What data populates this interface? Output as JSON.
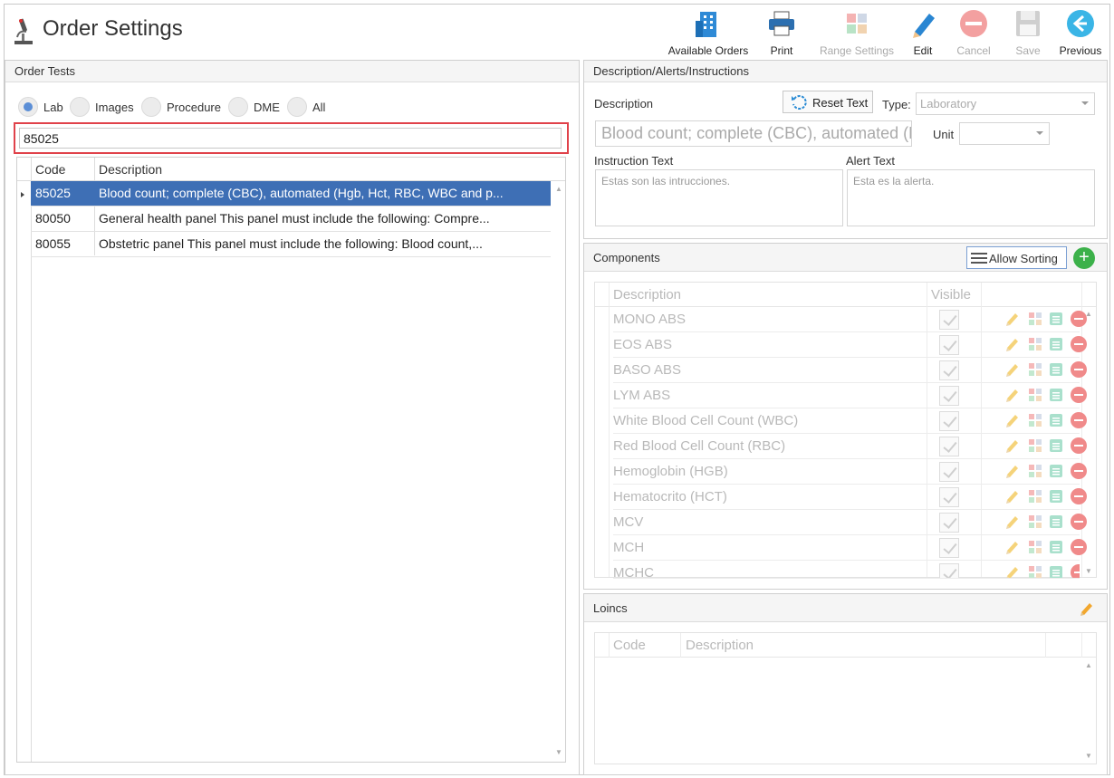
{
  "app": {
    "title": "Order Settings",
    "icon": "microscope-icon"
  },
  "toolbar": [
    {
      "id": "available-orders",
      "label": "Available Orders",
      "icon": "building-icon",
      "enabled": true
    },
    {
      "id": "print",
      "label": "Print",
      "icon": "printer-icon",
      "enabled": true
    },
    {
      "id": "range-settings",
      "label": "Range Settings",
      "icon": "puzzle-icon",
      "enabled": false
    },
    {
      "id": "edit",
      "label": "Edit",
      "icon": "pencil-icon",
      "enabled": true
    },
    {
      "id": "cancel",
      "label": "Cancel",
      "icon": "cancel-icon",
      "enabled": false
    },
    {
      "id": "save",
      "label": "Save",
      "icon": "floppy-icon",
      "enabled": false
    },
    {
      "id": "previous",
      "label": "Previous",
      "icon": "arrow-left-icon",
      "enabled": true
    }
  ],
  "order_tests": {
    "title": "Order Tests",
    "filters": [
      {
        "label": "Lab",
        "selected": true
      },
      {
        "label": "Images",
        "selected": false
      },
      {
        "label": "Procedure",
        "selected": false
      },
      {
        "label": "DME",
        "selected": false
      },
      {
        "label": "All",
        "selected": false
      }
    ],
    "search_value": "85025",
    "columns": {
      "code": "Code",
      "description": "Description"
    },
    "rows": [
      {
        "code": "85025",
        "description": "Blood count; complete (CBC), automated (Hgb, Hct, RBC, WBC and p...",
        "selected": true
      },
      {
        "code": "80050",
        "description": "General health panel This panel must include the following: Compre...",
        "selected": false
      },
      {
        "code": "80055",
        "description": "Obstetric panel This panel must include the following: Blood count,...",
        "selected": false
      }
    ]
  },
  "description_panel": {
    "title": "Description/Alerts/Instructions",
    "description_label": "Description",
    "reset_label": "Reset Text",
    "type_label": "Type:",
    "type_value": "Laboratory",
    "description_value": "Blood count; complete (CBC), automated (H",
    "unit_label": "Unit",
    "unit_value": "",
    "instruction_label": "Instruction Text",
    "instruction_value": "Estas son las intrucciones.",
    "alert_label": "Alert Text",
    "alert_value": "Esta es la alerta."
  },
  "components": {
    "title": "Components",
    "sort_label": "Allow Sorting",
    "columns": {
      "description": "Description",
      "visible": "Visible"
    },
    "rows": [
      "MONO ABS",
      "EOS ABS",
      "BASO ABS",
      "LYM ABS",
      "White Blood Cell Count (WBC)",
      "Red Blood Cell Count (RBC)",
      "Hemoglobin (HGB)",
      "Hematocrito (HCT)",
      "MCV",
      "MCH",
      "MCHC"
    ]
  },
  "loincs": {
    "title": "Loincs",
    "columns": {
      "code": "Code",
      "description": "Description"
    }
  },
  "colors": {
    "selection": "#3e6fb5",
    "search_border": "#e0424a",
    "add": "#3cb14a"
  }
}
